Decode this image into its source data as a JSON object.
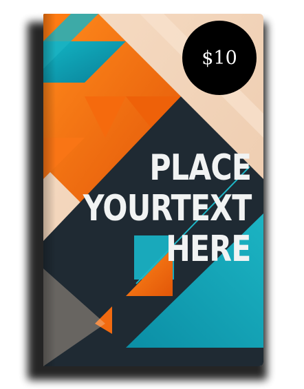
{
  "cover": {
    "headline": [
      "PLACE",
      "YOURTEXT",
      "HERE"
    ],
    "price": "$10"
  },
  "colors": {
    "cream": "#f2d6bd",
    "navy": "#1f2a33",
    "teal": "#1aa8b8",
    "orange": "#f26a10",
    "text": "#f1f3f3",
    "badge": "#000000"
  }
}
